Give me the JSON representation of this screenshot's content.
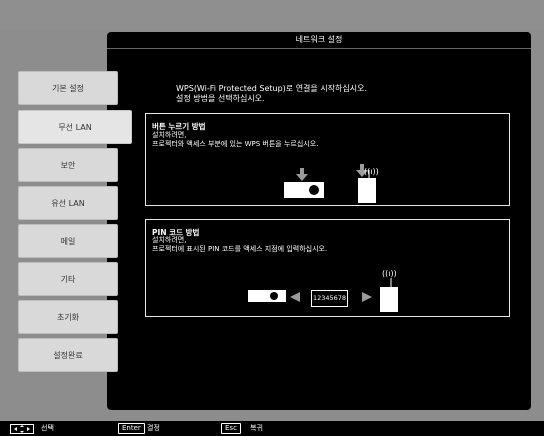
{
  "window": {
    "title": "네트워크 설정"
  },
  "sidebar": {
    "items": [
      {
        "label": "기본 설정"
      },
      {
        "label": "무선 LAN"
      },
      {
        "label": "보안"
      },
      {
        "label": "유선 LAN"
      },
      {
        "label": "메일"
      },
      {
        "label": "기타"
      },
      {
        "label": "초기화"
      },
      {
        "label": "설정완료"
      }
    ]
  },
  "main": {
    "intro_text": "WPS(Wi-Fi Protected Setup)로 연결을 시작하십시오.\n설정 방법을 선택하십시오.",
    "push_button": {
      "title": "버튼 누르기 방법",
      "desc": "설치하려면,\n프로젝터와 액세스 부분에 있는 WPS 버튼을 누르십시오."
    },
    "pin": {
      "title": "PIN 코드 방법",
      "desc": "설치하려면,\n프로젝터에 표시된 PIN 코드를 액세스 지점에 입력하십시오.",
      "code": "12345678"
    }
  },
  "footer": {
    "select_label": "선택",
    "enter_key": "Enter",
    "enter_label": "결정",
    "esc_key": "Esc",
    "esc_label": "복귀"
  },
  "icons": {
    "move": "move-arrows-icon",
    "projector": "projector-icon",
    "access_point": "access-point-icon",
    "arrow_left": "arrow-left-icon",
    "arrow_right": "arrow-right-icon",
    "signal": "wireless-signal-icon"
  }
}
